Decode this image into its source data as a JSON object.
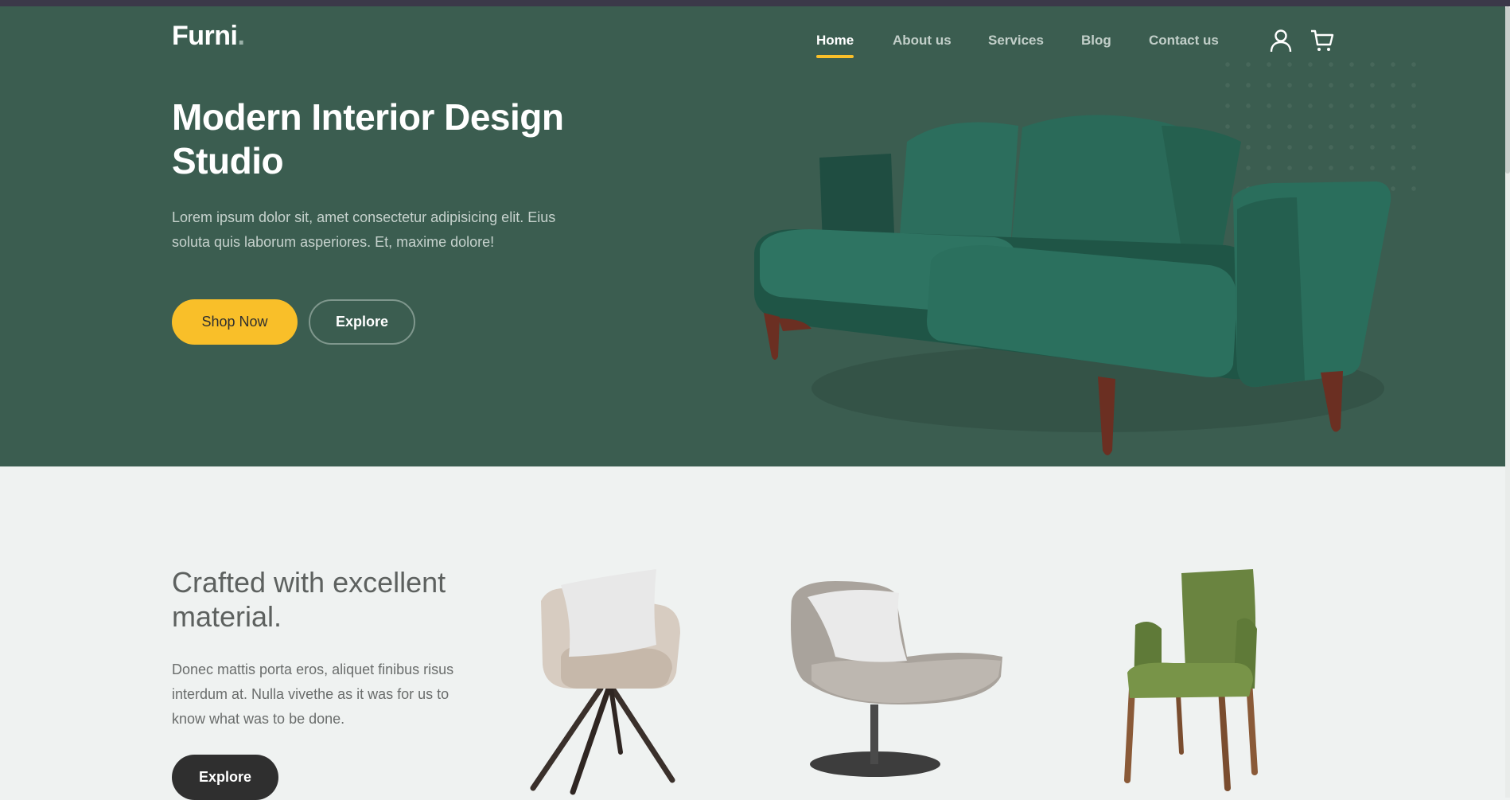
{
  "brand": {
    "name": "Furni",
    "dot": "."
  },
  "nav": {
    "items": [
      {
        "label": "Home",
        "active": true
      },
      {
        "label": "About us",
        "active": false
      },
      {
        "label": "Services",
        "active": false
      },
      {
        "label": "Blog",
        "active": false
      },
      {
        "label": "Contact us",
        "active": false
      }
    ],
    "icons": [
      "user-icon",
      "cart-icon"
    ]
  },
  "hero": {
    "title": "Modern Interior Design Studio",
    "description": "Lorem ipsum dolor sit, amet consectetur adipisicing elit. Eius soluta quis laborum asperiores. Et, maxime dolore!",
    "primary_button": "Shop Now",
    "secondary_button": "Explore"
  },
  "section": {
    "title": "Crafted with excellent material.",
    "description": "Donec mattis porta eros, aliquet finibus risus interdum at. Nulla vivethe as it was for us to know what was to be done.",
    "button": "Explore"
  },
  "colors": {
    "hero_bg": "#3b5d50",
    "accent": "#f9bf29",
    "page_bg": "#eff2f1",
    "dark_button": "#2f2f2f",
    "sofa": "#265b4d"
  }
}
